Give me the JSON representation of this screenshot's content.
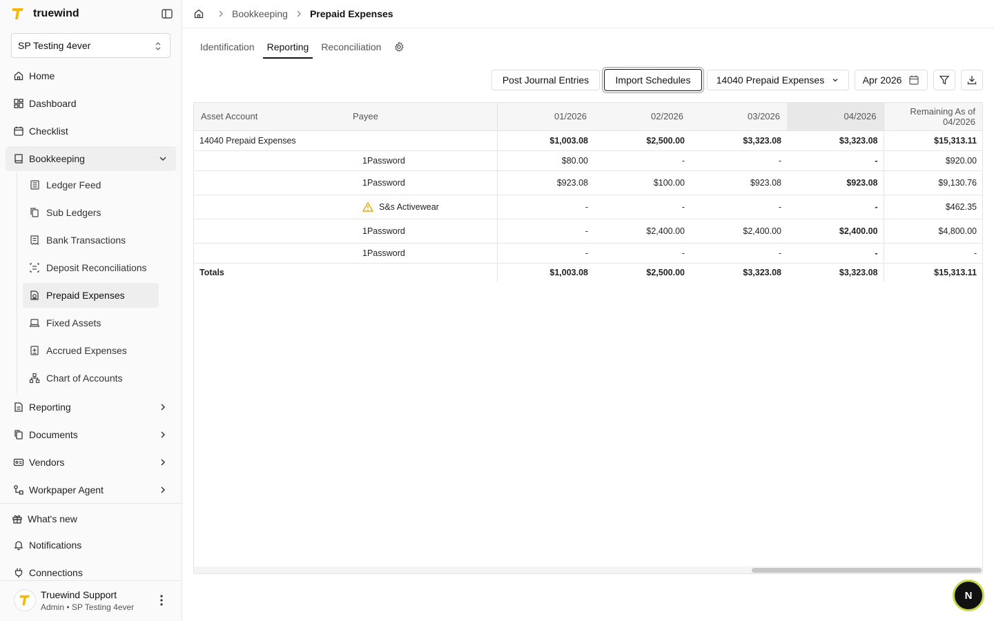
{
  "app": {
    "brand_name": "truewind",
    "org_selector": "SP Testing 4ever"
  },
  "sidebar": {
    "nav": [
      {
        "label": "Home",
        "icon": "home-icon"
      },
      {
        "label": "Dashboard",
        "icon": "dashboard-icon"
      },
      {
        "label": "Checklist",
        "icon": "calendar-icon"
      },
      {
        "label": "Bookkeeping",
        "icon": "book-icon",
        "expanded": true
      }
    ],
    "bookkeeping_items": [
      {
        "label": "Ledger Feed",
        "icon": "ledger-icon"
      },
      {
        "label": "Sub Ledgers",
        "icon": "copy-icon"
      },
      {
        "label": "Bank Transactions",
        "icon": "receipt-icon"
      },
      {
        "label": "Deposit Reconciliations",
        "icon": "deposit-icon"
      },
      {
        "label": "Prepaid Expenses",
        "icon": "prepaid-icon",
        "active": true
      },
      {
        "label": "Fixed Assets",
        "icon": "laptop-icon"
      },
      {
        "label": "Accrued Expenses",
        "icon": "accrued-icon"
      },
      {
        "label": "Chart of Accounts",
        "icon": "network-icon"
      }
    ],
    "more_nav": [
      {
        "label": "Reporting",
        "icon": "report-icon"
      },
      {
        "label": "Documents",
        "icon": "documents-icon"
      },
      {
        "label": "Vendors",
        "icon": "vendor-icon"
      },
      {
        "label": "Workpaper Agent",
        "icon": "workflow-icon"
      }
    ],
    "bottom_nav": [
      {
        "label": "What's new",
        "icon": "gift-icon"
      },
      {
        "label": "Notifications",
        "icon": "bell-icon"
      },
      {
        "label": "Connections",
        "icon": "plug-icon"
      }
    ],
    "user": {
      "name": "Truewind Support",
      "subtitle": "Admin • SP Testing 4ever"
    }
  },
  "breadcrumb": {
    "parent": "Bookkeeping",
    "current": "Prepaid Expenses"
  },
  "tabs": [
    {
      "label": "Identification",
      "active": false
    },
    {
      "label": "Reporting",
      "active": true
    },
    {
      "label": "Reconciliation",
      "active": false
    }
  ],
  "toolbar": {
    "post_journal_entries": "Post Journal Entries",
    "import_schedules": "Import Schedules",
    "account_filter": "14040 Prepaid Expenses",
    "period": "Apr 2026"
  },
  "table": {
    "columns": [
      "Asset Account",
      "Payee",
      "01/2026",
      "02/2026",
      "03/2026",
      "04/2026",
      "Remaining As of 04/2026"
    ],
    "group_row": {
      "account": "14040 Prepaid Expenses",
      "values": [
        "$1,003.08",
        "$2,500.00",
        "$3,323.08",
        "$3,323.08",
        "$15,313.11"
      ]
    },
    "rows": [
      {
        "payee": "1Password",
        "warning": false,
        "values": [
          "$80.00",
          "-",
          "-",
          "-",
          "$920.00"
        ]
      },
      {
        "payee": "1Password",
        "warning": false,
        "values": [
          "$923.08",
          "$100.00",
          "$923.08",
          "$923.08",
          "$9,130.76"
        ]
      },
      {
        "payee": "S&s Activewear",
        "warning": true,
        "values": [
          "-",
          "-",
          "-",
          "-",
          "$462.35"
        ]
      },
      {
        "payee": "1Password",
        "warning": false,
        "values": [
          "-",
          "$2,400.00",
          "$2,400.00",
          "$2,400.00",
          "$4,800.00"
        ]
      },
      {
        "payee": "1Password",
        "warning": false,
        "values": [
          "-",
          "-",
          "-",
          "-",
          "-"
        ]
      }
    ],
    "totals": {
      "label": "Totals",
      "values": [
        "$1,003.08",
        "$2,500.00",
        "$3,323.08",
        "$3,323.08",
        "$15,313.11"
      ]
    }
  },
  "assistant_button": {
    "label": "N"
  },
  "colors": {
    "brand": "#f5b800",
    "accent": "#111111",
    "warning": "#e0a800"
  }
}
